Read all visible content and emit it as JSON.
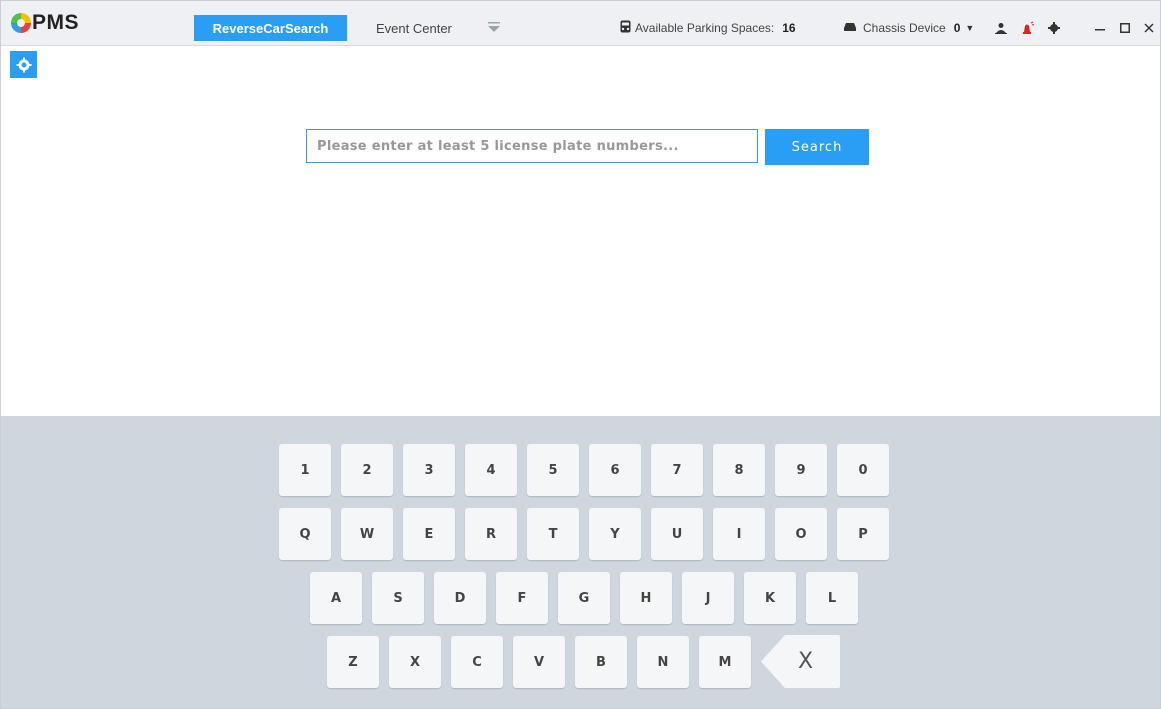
{
  "app": {
    "logo_text": "PMS"
  },
  "header": {
    "tabs": [
      {
        "label": "ReverseCarSearch",
        "active": true
      },
      {
        "label": "Event Center",
        "active": false
      }
    ],
    "more_icon": "chevron-down-icon",
    "parking": {
      "label": "Available Parking Spaces:",
      "value": "16",
      "icon": "parking-car-icon"
    },
    "chassis": {
      "label": "Chassis Device",
      "value": "0",
      "icon": "car-icon"
    },
    "icons": [
      "user-icon",
      "alarm-icon",
      "gear-icon"
    ],
    "window_controls": [
      "minimize-icon",
      "maximize-icon",
      "close-icon"
    ]
  },
  "sidebar": {
    "icon": "settings-icon"
  },
  "search": {
    "placeholder": "Please enter at least 5 license plate numbers...",
    "value": "",
    "button_label": "Search"
  },
  "keyboard": {
    "row1": [
      "1",
      "2",
      "3",
      "4",
      "5",
      "6",
      "7",
      "8",
      "9",
      "0"
    ],
    "row2": [
      "Q",
      "W",
      "E",
      "R",
      "T",
      "Y",
      "U",
      "I",
      "O",
      "P"
    ],
    "row3": [
      "A",
      "S",
      "D",
      "F",
      "G",
      "H",
      "J",
      "K",
      "L"
    ],
    "row4": [
      "Z",
      "X",
      "C",
      "V",
      "B",
      "N",
      "M"
    ],
    "backspace_label": "X"
  },
  "colors": {
    "accent": "#2a9df4",
    "header_bg": "#eef0f4",
    "keyboard_bg": "#cfd6dd",
    "key_bg": "#f5f6f7"
  }
}
